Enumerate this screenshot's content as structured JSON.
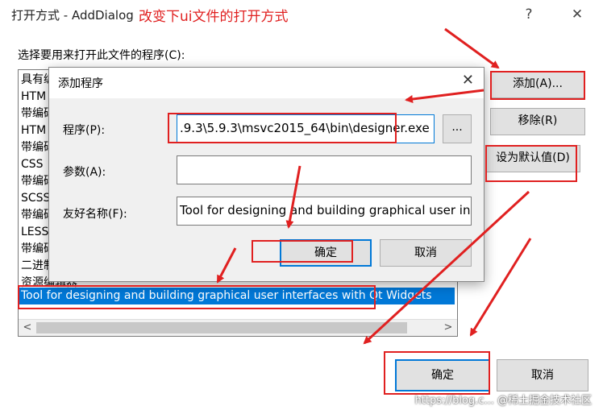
{
  "window": {
    "title": "打开方式 - AddDialog",
    "help_glyph": "?",
    "close_glyph": "✕"
  },
  "annotation": {
    "text": "改变下ui文件的打开方式",
    "color": "#e02020"
  },
  "prompt": "选择要用来打开此文件的程序(C):",
  "program_list": {
    "items": [
      "具有编",
      "HTM",
      "带编码",
      "HTM",
      "带编码",
      "CSS",
      "带编码",
      "SCSS",
      "带编码",
      "LESS",
      "带编码",
      "二进制",
      "资源编辑器"
    ],
    "selected_item": "Tool for designing and building graphical user interfaces with Qt Widgets"
  },
  "side_buttons": {
    "add": "添加(A)...",
    "remove": "移除(R)",
    "set_default": "设为默认值(D)"
  },
  "bottom_buttons": {
    "ok": "确定",
    "cancel": "取消"
  },
  "add_program_dialog": {
    "title": "添加程序",
    "close_glyph": "✕",
    "program_label": "程序(P):",
    "program_value": ".9.3\\5.9.3\\msvc2015_64\\bin\\designer.exe",
    "browse_label": "...",
    "params_label": "参数(A):",
    "params_value": "",
    "friendly_label": "友好名称(F):",
    "friendly_value": "Tool for designing and building graphical user in",
    "ok": "确定",
    "cancel": "取消"
  },
  "scrollbar": {
    "left_glyph": "<",
    "right_glyph": ">"
  },
  "watermark": "https://blog.c... @稀土掘金技术社区",
  "accent_color": "#0078d7"
}
